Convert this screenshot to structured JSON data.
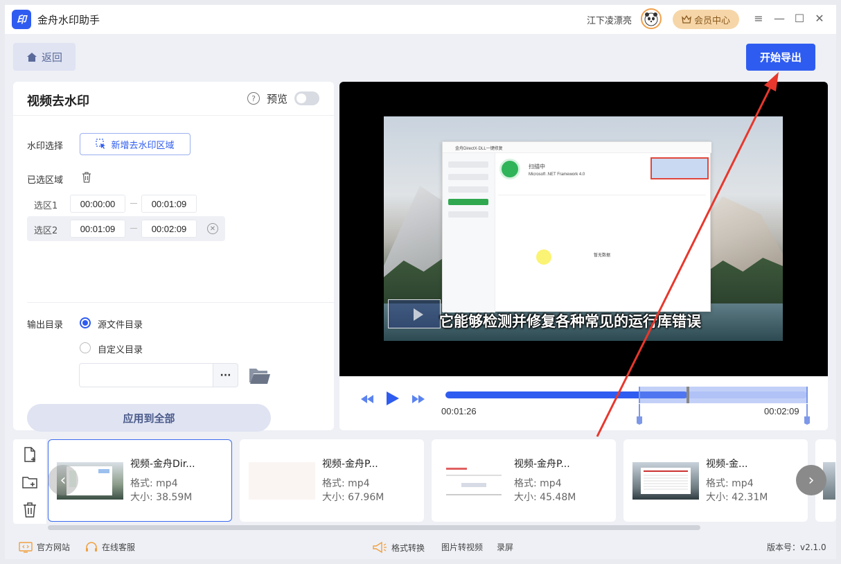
{
  "app": {
    "title": "金舟水印助手",
    "logo_text": "印",
    "username": "江下凌漂亮",
    "vip_label": "会员中心",
    "controls": [
      "≡",
      "—",
      "☐",
      "✕"
    ]
  },
  "toolbar": {
    "back_label": "返回",
    "export_label": "开始导出"
  },
  "left_panel": {
    "title": "视频去水印",
    "preview_label": "预览",
    "preview_enabled": false,
    "watermark_select_label": "水印选择",
    "add_region_label": "新增去水印区域",
    "selected_regions_label": "已选区域",
    "regions": [
      {
        "name": "选区1",
        "start": "00:00:00",
        "end": "00:01:09",
        "active": false
      },
      {
        "name": "选区2",
        "start": "00:01:09",
        "end": "00:02:09",
        "active": true
      }
    ],
    "output_dir_label": "输出目录",
    "output_options": [
      {
        "label": "源文件目录",
        "checked": true
      },
      {
        "label": "自定义目录",
        "checked": false
      }
    ],
    "path_value": "",
    "more_label": "···",
    "apply_all_label": "应用到全部"
  },
  "video": {
    "subtitle": "它能够检测并修复各种常见的运行库错误",
    "inner_app": {
      "title": "金舟DirectX·DLL一键修复",
      "status": "扫描中",
      "detail": "Microsoft .NET Framework 4.0",
      "empty_text": "暂无数据"
    },
    "current_time": "00:01:26",
    "end_time": "00:02:09",
    "progress": 0.67
  },
  "files": [
    {
      "name": "视频-金舟Dir...",
      "format": "格式: mp4",
      "size": "大小: 38.59M",
      "selected": true
    },
    {
      "name": "视频-金舟P...",
      "format": "格式: mp4",
      "size": "大小: 67.96M",
      "selected": false
    },
    {
      "name": "视频-金舟P...",
      "format": "格式: mp4",
      "size": "大小: 45.48M",
      "selected": false
    },
    {
      "name": "视频-金...",
      "format": "格式: mp4",
      "size": "大小: 42.31M",
      "selected": false
    }
  ],
  "footer": {
    "website": "官方网站",
    "support": "在线客服",
    "format_convert": "格式转换",
    "image_to_video": "图片转视频",
    "record": "录屏",
    "version": "版本号：v2.1.0"
  },
  "colors": {
    "accent": "#2f5cf0",
    "annotation_arrow": "#e8372c"
  }
}
